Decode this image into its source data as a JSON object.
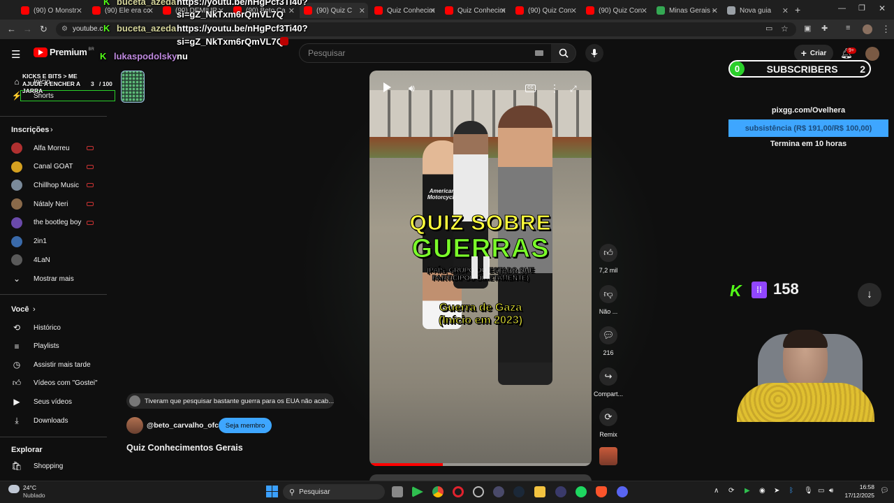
{
  "browser": {
    "tabs": [
      {
        "label": "(90) O Monstr",
        "color": "#ff0000"
      },
      {
        "label": "(90) Ele era co",
        "color": "#ff0000"
      },
      {
        "label": "(90) DEMIUR",
        "color": "#ff0000"
      },
      {
        "label": "(90) Beto Ca",
        "color": "#ff0000"
      },
      {
        "label": "(90) Quiz C",
        "color": "#ff0000"
      },
      {
        "label": "Quiz Conhecim",
        "color": "#ff0000"
      },
      {
        "label": "Quiz Conhecim",
        "color": "#ff0000"
      },
      {
        "label": "(90) Quiz Con",
        "color": "#ff0000"
      },
      {
        "label": "(90) Quiz Con",
        "color": "#ff0000"
      },
      {
        "label": "Minas Gerais -",
        "color": "#34a853"
      },
      {
        "label": "Nova guia",
        "color": "#9aa0a6"
      }
    ],
    "address": "youtube.c"
  },
  "chat_overlay": {
    "user1": "buceta_azeda",
    "msg1_line1": "https://youtu.be/nHgPcf3Ti40?",
    "msg1_line2": "si=gZ_NkTxm6rQmVL7Q",
    "user2": "buceta_azeda",
    "msg2_line1": "https://youtu.be/nHgPcf3Ti40?",
    "msg2_line2": "si=gZ_NkTxm6rQmVL7Q",
    "user3": "lukaspodolsky",
    "msg3": "nu"
  },
  "header": {
    "logo_text": "Premium",
    "logo_badge": "BR",
    "search_placeholder": "Pesquisar",
    "create_label": "Criar",
    "notif_badge": "9+"
  },
  "goal_widget": {
    "title": "KICKS E BITS > ME AJUDE A ENCHER A JARRA",
    "count": "3",
    "total": "/ 100"
  },
  "sidebar": {
    "top_items": [
      {
        "label": "Início",
        "icon": "home-icon"
      },
      {
        "label": "Shorts",
        "icon": "shorts-icon"
      }
    ],
    "subs_header": "Inscrições",
    "subscriptions": [
      {
        "label": "Alfa Morreu",
        "color": "#b03030",
        "live": true
      },
      {
        "label": "Canal GOAT",
        "color": "#d4a020",
        "live": true
      },
      {
        "label": "Chillhop Music",
        "color": "#7a8a9a",
        "live": true
      },
      {
        "label": "Nátaly Neri",
        "color": "#8a6a4a",
        "live": true
      },
      {
        "label": "the bootleg boy",
        "color": "#6a4aaa",
        "live": true
      },
      {
        "label": "2in1",
        "color": "#3a6aaa",
        "live": false
      },
      {
        "label": "4LaN",
        "color": "#5a5a5a",
        "live": false
      }
    ],
    "show_more": "Mostrar mais",
    "you_header": "Você",
    "you_items": [
      {
        "label": "Histórico",
        "icon": "history-icon"
      },
      {
        "label": "Playlists",
        "icon": "playlist-icon"
      },
      {
        "label": "Assistir mais tarde",
        "icon": "watch-later-icon"
      },
      {
        "label": "Vídeos com \"Gostei\"",
        "icon": "like-icon"
      },
      {
        "label": "Seus vídeos",
        "icon": "your-videos-icon"
      },
      {
        "label": "Downloads",
        "icon": "download-icon"
      }
    ],
    "explore_header": "Explorar",
    "explore_items": [
      {
        "label": "Shopping",
        "icon": "shopping-icon"
      }
    ]
  },
  "short": {
    "title_line1": "QUIZ SOBRE",
    "title_line2": "GUERRAS",
    "subtitle_line1": "(PAÍS, GRUPO OU ESTADO QUE",
    "subtitle_line2": "PARTICIPOU DIRETAMENTE)",
    "question_line1": "Guerra de Gaza",
    "question_line2": "(Início em 2023)",
    "shirt_text": "American Motorcycle",
    "progress": 0.33,
    "comment_preview": "Tiveram que pesquisar bastante guerra para os EUA não acab...",
    "channel": "@beto_carvalho_ofc",
    "member_button": "Seja membro",
    "video_title": "Quiz Conhecimentos Gerais",
    "likes": "7,2 mil",
    "dislike_label": "Não ...",
    "comments": "216",
    "share_label": "Compart...",
    "remix_label": "Remix"
  },
  "stream_overlay": {
    "subs_count_left": "0",
    "subs_label": "SUBSCRIBERS",
    "subs_count_right": "2",
    "pix_url": "pixgg.com/Ovelhera",
    "pix_goal": "subsistência (R$ 191,00/R$ 100,00)",
    "pix_ends": "Termina em 10 horas",
    "viewers": "158"
  },
  "taskbar": {
    "weather_temp": "24°C",
    "weather_desc": "Nublado",
    "search_label": "Pesquisar",
    "time": "16:58",
    "date": "17/12/2025"
  },
  "colors": {
    "youtube_red": "#ff0000",
    "kick_green": "#53fc18",
    "twitch_purple": "#9146ff",
    "pix_blue": "#3ea6ff",
    "member_blue": "#3ea6ff"
  }
}
